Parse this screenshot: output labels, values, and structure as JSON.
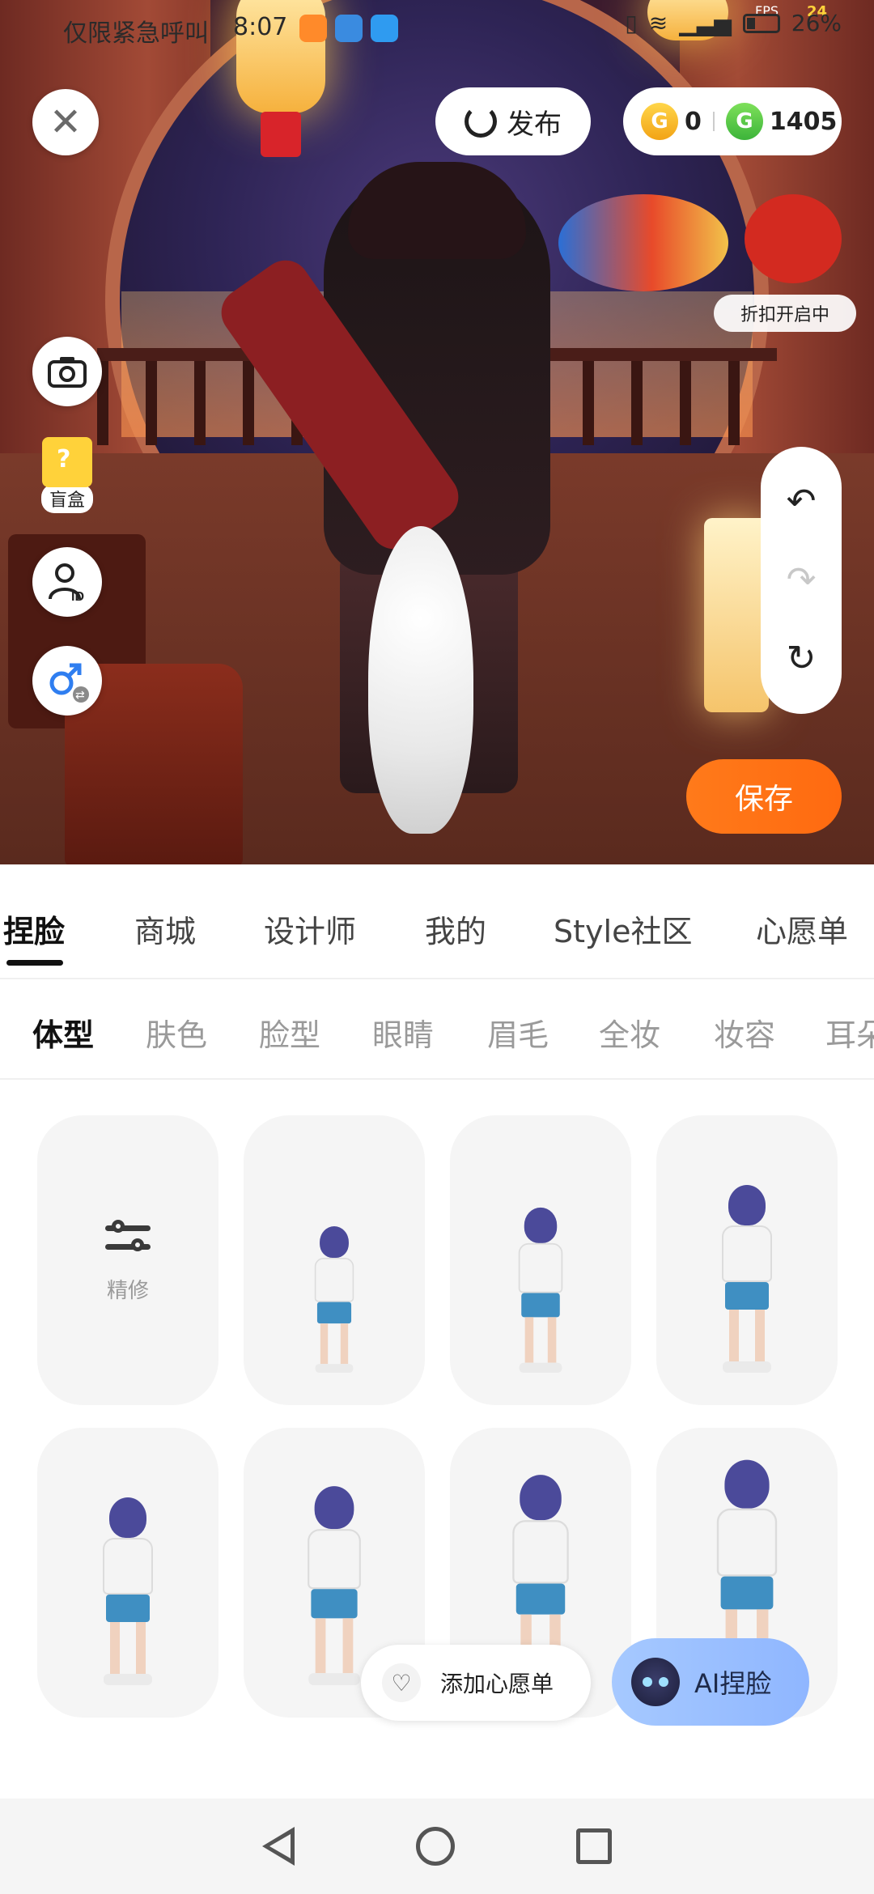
{
  "status_bar": {
    "emergency_text": "仅限紧急呼叫",
    "time": "8:07",
    "fps_label": "FPS",
    "fps_value": "24",
    "battery": "26%"
  },
  "header": {
    "close_label": "✕",
    "publish_label": "发布",
    "coins_gold": "0",
    "coins_green": "1405",
    "coin_gold_icon": "G",
    "coin_green_icon": "G",
    "discount_label": "折扣开启中"
  },
  "side_tools": {
    "camera_icon": "camera-icon",
    "blindbox_label": "盲盒",
    "profile_icon": "profile-id-icon",
    "gender_icon": "gender-switch-icon"
  },
  "history": {
    "undo": "↶",
    "redo": "↷",
    "reset": "↻"
  },
  "save_label": "保存",
  "main_tabs": [
    {
      "label": "捏脸",
      "active": true
    },
    {
      "label": "商城"
    },
    {
      "label": "设计师"
    },
    {
      "label": "我的"
    },
    {
      "label": "Style社区"
    },
    {
      "label": "心愿单"
    }
  ],
  "sub_tabs": [
    {
      "label": "体型",
      "active": true
    },
    {
      "label": "肤色"
    },
    {
      "label": "脸型"
    },
    {
      "label": "眼睛"
    },
    {
      "label": "眉毛"
    },
    {
      "label": "全妆"
    },
    {
      "label": "妆容"
    },
    {
      "label": "耳朵"
    }
  ],
  "grid": {
    "refine_label": "精修",
    "body_types": 7
  },
  "wishlist_label": "添加心愿单",
  "wishlist_icon": "♡",
  "ai_label": "AI捏脸",
  "colors": {
    "accent_orange": "#ff7a1a",
    "ai_blue": "#a6c9ff",
    "shorts_blue": "#3f8fc2",
    "hair_purple": "#4b4a9a"
  }
}
